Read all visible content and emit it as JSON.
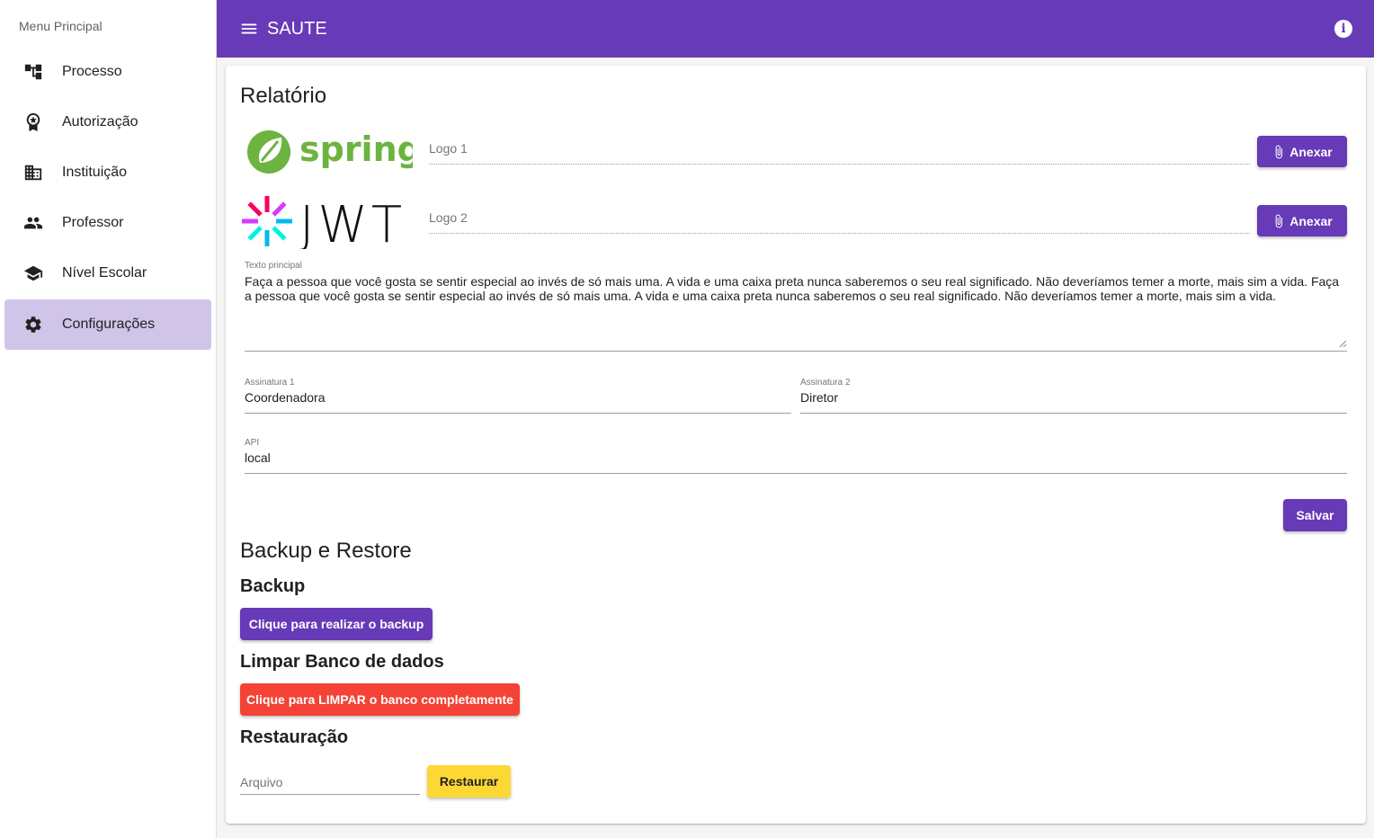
{
  "sidebar": {
    "header": "Menu Principal",
    "items": [
      {
        "label": "Processo",
        "icon": "account-tree-icon"
      },
      {
        "label": "Autorização",
        "icon": "badge-icon"
      },
      {
        "label": "Instituição",
        "icon": "domain-icon"
      },
      {
        "label": "Professor",
        "icon": "people-icon"
      },
      {
        "label": "Nível Escolar",
        "icon": "school-icon"
      },
      {
        "label": "Configurações",
        "icon": "settings-icon",
        "active": true
      }
    ]
  },
  "topbar": {
    "title": "SAUTE",
    "color": "#673ab7"
  },
  "relatorio": {
    "title": "Relatório",
    "logo1": {
      "placeholder": "Logo 1",
      "button": "Anexar",
      "image_text": "spring"
    },
    "logo2": {
      "placeholder": "Logo 2",
      "button": "Anexar",
      "image_text": "JWT"
    },
    "texto_principal": {
      "label": "Texto principal",
      "value": "Faça a pessoa que você gosta se sentir especial ao invés de só mais uma. A vida e uma caixa preta nunca saberemos o seu real significado. Não deveríamos temer a morte, mais sim a vida. Faça a pessoa que você gosta se sentir especial ao invés de só mais uma. A vida e uma caixa preta nunca saberemos o seu real significado. Não deveríamos temer a morte, mais sim a vida."
    },
    "assinatura1": {
      "label": "Assinatura 1",
      "value": "Coordenadora"
    },
    "assinatura2": {
      "label": "Assinatura 2",
      "value": "Diretor"
    },
    "api": {
      "label": "API",
      "value": "local"
    },
    "save_button": "Salvar"
  },
  "backup_restore": {
    "title": "Backup e Restore",
    "backup": {
      "title": "Backup",
      "button": "Clique para realizar o backup"
    },
    "limpar": {
      "title": "Limpar Banco de dados",
      "button": "Clique para LIMPAR o banco completamente"
    },
    "restauracao": {
      "title": "Restauração",
      "file_placeholder": "Arquivo",
      "button": "Restaurar"
    }
  },
  "colors": {
    "primary": "#673ab7",
    "active_nav": "#d1c4e9",
    "danger": "#f44336",
    "warning": "#fdd835"
  }
}
